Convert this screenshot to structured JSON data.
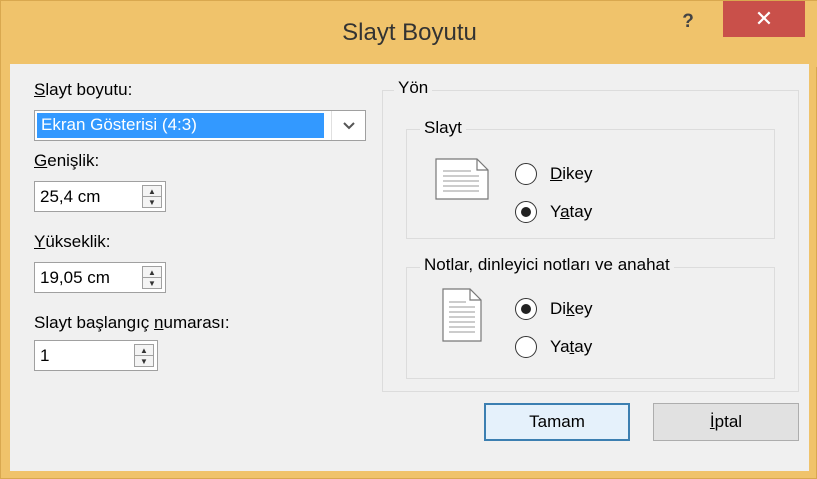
{
  "window": {
    "title": "Slayt Boyutu",
    "help_label": "?",
    "close_label": "✕"
  },
  "slide_size": {
    "label_prefix": "S",
    "label_rest": "layt boyutu:",
    "selected": "Ekran Gösterisi (4:3)"
  },
  "width": {
    "label_prefix": "G",
    "label_rest": "enişlik:",
    "value": "25,4 cm"
  },
  "height": {
    "label_prefix": "Y",
    "label_rest": "ükseklik:",
    "value": "19,05 cm"
  },
  "start_number": {
    "label_before": "Slayt başlangıç ",
    "label_u": "n",
    "label_after": "umarası:",
    "value": "1"
  },
  "orientation": {
    "title": "Yön",
    "slides": {
      "title": "Slayt",
      "portrait_pre": "",
      "portrait_u": "D",
      "portrait_post": "ikey",
      "landscape_pre": "Y",
      "landscape_u": "a",
      "landscape_post": "tay",
      "selected": "landscape"
    },
    "notes": {
      "title": "Notlar, dinleyici notları ve anahat",
      "portrait_pre": "Di",
      "portrait_u": "k",
      "portrait_post": "ey",
      "landscape_pre": "Ya",
      "landscape_u": "t",
      "landscape_post": "ay",
      "selected": "portrait"
    }
  },
  "buttons": {
    "ok": "Tamam",
    "cancel_pre": "İ",
    "cancel_rest": "ptal"
  }
}
